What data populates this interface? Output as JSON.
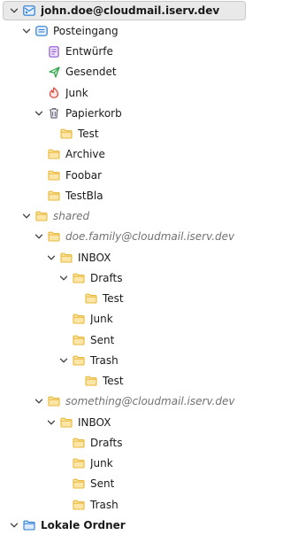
{
  "colors": {
    "folder": "#e8b83a",
    "folder_fill": "#fbe6a8",
    "account_blue": "#2a7cd3",
    "drafts_purple": "#8b4fd6",
    "sent_green": "#2aa244",
    "junk_red": "#e23a2e",
    "trash_grey": "#6a6a7a"
  },
  "tree": [
    {
      "name": "account-john-doe",
      "label": "john.doe@cloudmail.iserv.dev",
      "icon": "account-mail-icon",
      "level": 0,
      "twisty": "down",
      "style": "bold",
      "selected": true
    },
    {
      "name": "folder-posteingang",
      "label": "Posteingang",
      "icon": "inbox-icon",
      "level": 1,
      "twisty": "down"
    },
    {
      "name": "folder-entwuerfe",
      "label": "Entwürfe",
      "icon": "drafts-icon",
      "level": 2,
      "twisty": "none"
    },
    {
      "name": "folder-gesendet",
      "label": "Gesendet",
      "icon": "sent-icon",
      "level": 2,
      "twisty": "none"
    },
    {
      "name": "folder-junk",
      "label": "Junk",
      "icon": "junk-icon",
      "level": 2,
      "twisty": "none"
    },
    {
      "name": "folder-papierkorb",
      "label": "Papierkorb",
      "icon": "trash-icon",
      "level": 2,
      "twisty": "down"
    },
    {
      "name": "folder-papierkorb-test",
      "label": "Test",
      "icon": "folder-icon",
      "level": 3,
      "twisty": "none"
    },
    {
      "name": "folder-archive",
      "label": "Archive",
      "icon": "folder-icon",
      "level": 2,
      "twisty": "none"
    },
    {
      "name": "folder-foobar",
      "label": "Foobar",
      "icon": "folder-icon",
      "level": 2,
      "twisty": "none"
    },
    {
      "name": "folder-testbla",
      "label": "TestBla",
      "icon": "folder-icon",
      "level": 2,
      "twisty": "none"
    },
    {
      "name": "folder-shared",
      "label": "shared",
      "icon": "folder-icon",
      "level": 1,
      "twisty": "down",
      "style": "ital"
    },
    {
      "name": "folder-doe-family",
      "label": "doe.family@cloudmail.iserv.dev",
      "icon": "folder-icon",
      "level": 2,
      "twisty": "down",
      "style": "ital"
    },
    {
      "name": "folder-doe-family-inbox",
      "label": "INBOX",
      "icon": "folder-icon",
      "level": 3,
      "twisty": "down"
    },
    {
      "name": "folder-doe-family-drafts",
      "label": "Drafts",
      "icon": "folder-icon",
      "level": 4,
      "twisty": "down"
    },
    {
      "name": "folder-doe-family-drafts-test",
      "label": "Test",
      "icon": "folder-icon",
      "level": 5,
      "twisty": "none"
    },
    {
      "name": "folder-doe-family-junk",
      "label": "Junk",
      "icon": "folder-icon",
      "level": 4,
      "twisty": "none"
    },
    {
      "name": "folder-doe-family-sent",
      "label": "Sent",
      "icon": "folder-icon",
      "level": 4,
      "twisty": "none"
    },
    {
      "name": "folder-doe-family-trash",
      "label": "Trash",
      "icon": "folder-icon",
      "level": 4,
      "twisty": "down"
    },
    {
      "name": "folder-doe-family-trash-test",
      "label": "Test",
      "icon": "folder-icon",
      "level": 5,
      "twisty": "none"
    },
    {
      "name": "folder-something",
      "label": "something@cloudmail.iserv.dev",
      "icon": "folder-icon",
      "level": 2,
      "twisty": "down",
      "style": "ital"
    },
    {
      "name": "folder-something-inbox",
      "label": "INBOX",
      "icon": "folder-icon",
      "level": 3,
      "twisty": "down"
    },
    {
      "name": "folder-something-drafts",
      "label": "Drafts",
      "icon": "folder-icon",
      "level": 4,
      "twisty": "none"
    },
    {
      "name": "folder-something-junk",
      "label": "Junk",
      "icon": "folder-icon",
      "level": 4,
      "twisty": "none"
    },
    {
      "name": "folder-something-sent",
      "label": "Sent",
      "icon": "folder-icon",
      "level": 4,
      "twisty": "none"
    },
    {
      "name": "folder-something-trash",
      "label": "Trash",
      "icon": "folder-icon",
      "level": 4,
      "twisty": "none"
    },
    {
      "name": "account-lokale-ordner",
      "label": "Lokale Ordner",
      "icon": "local-folders-icon",
      "level": 0,
      "twisty": "down",
      "style": "bold"
    }
  ]
}
